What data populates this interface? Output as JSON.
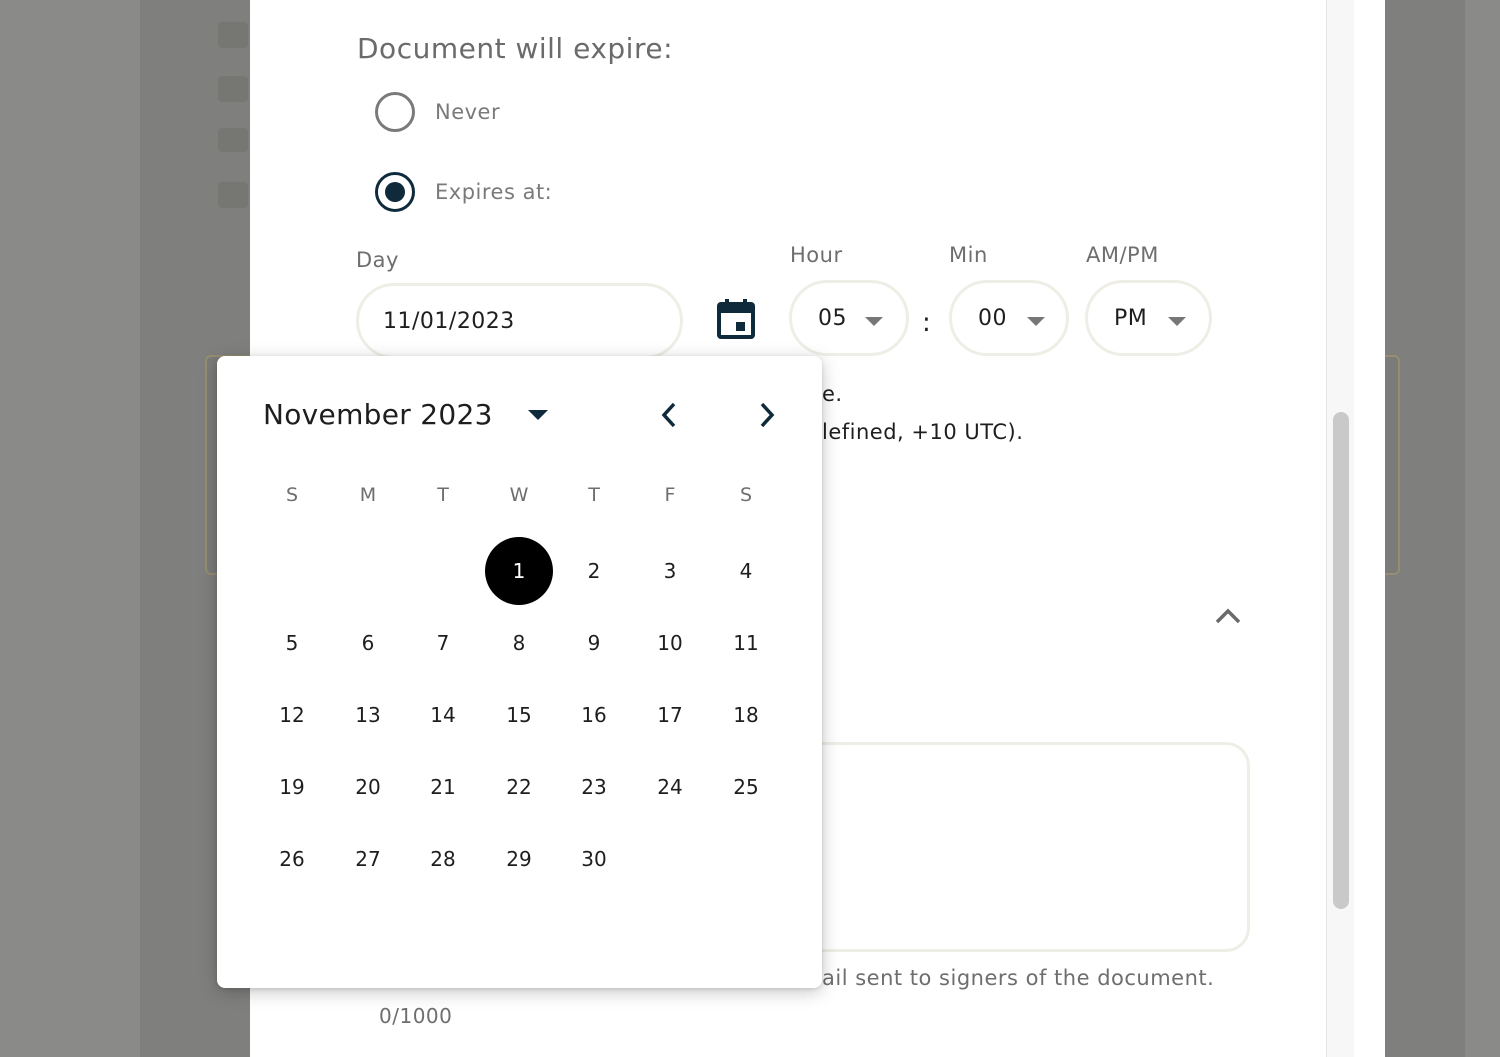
{
  "expiry": {
    "title": "Document will expire:",
    "options": [
      {
        "label": "Never",
        "checked": false
      },
      {
        "label": "Expires at:",
        "checked": true
      }
    ],
    "day_label": "Day",
    "day_value": "11/01/2023",
    "hour_label": "Hour",
    "hour_value": "05",
    "min_label": "Min",
    "min_value": "00",
    "ampm_label": "AM/PM",
    "ampm_value": "PM",
    "separator": ":"
  },
  "background_text": {
    "line1": "e.",
    "line2": "lefined, +10 UTC).",
    "helper": "ail sent to signers of the document.",
    "counter": "0/1000"
  },
  "datepicker": {
    "month_label": "November 2023",
    "weekdays": [
      "S",
      "M",
      "T",
      "W",
      "T",
      "F",
      "S"
    ],
    "first_weekday_index": 3,
    "days": [
      "1",
      "2",
      "3",
      "4",
      "5",
      "6",
      "7",
      "8",
      "9",
      "10",
      "11",
      "12",
      "13",
      "14",
      "15",
      "16",
      "17",
      "18",
      "19",
      "20",
      "21",
      "22",
      "23",
      "24",
      "25",
      "26",
      "27",
      "28",
      "29",
      "30"
    ],
    "selected_day": "1"
  },
  "colors": {
    "accent": "#0f2a3a",
    "selected_day_bg": "#000000",
    "pill_border": "#efeee6"
  },
  "icons": [
    "calendar-icon",
    "chevron-left-icon",
    "chevron-right-icon",
    "caret-down-icon",
    "chevron-up-icon"
  ]
}
